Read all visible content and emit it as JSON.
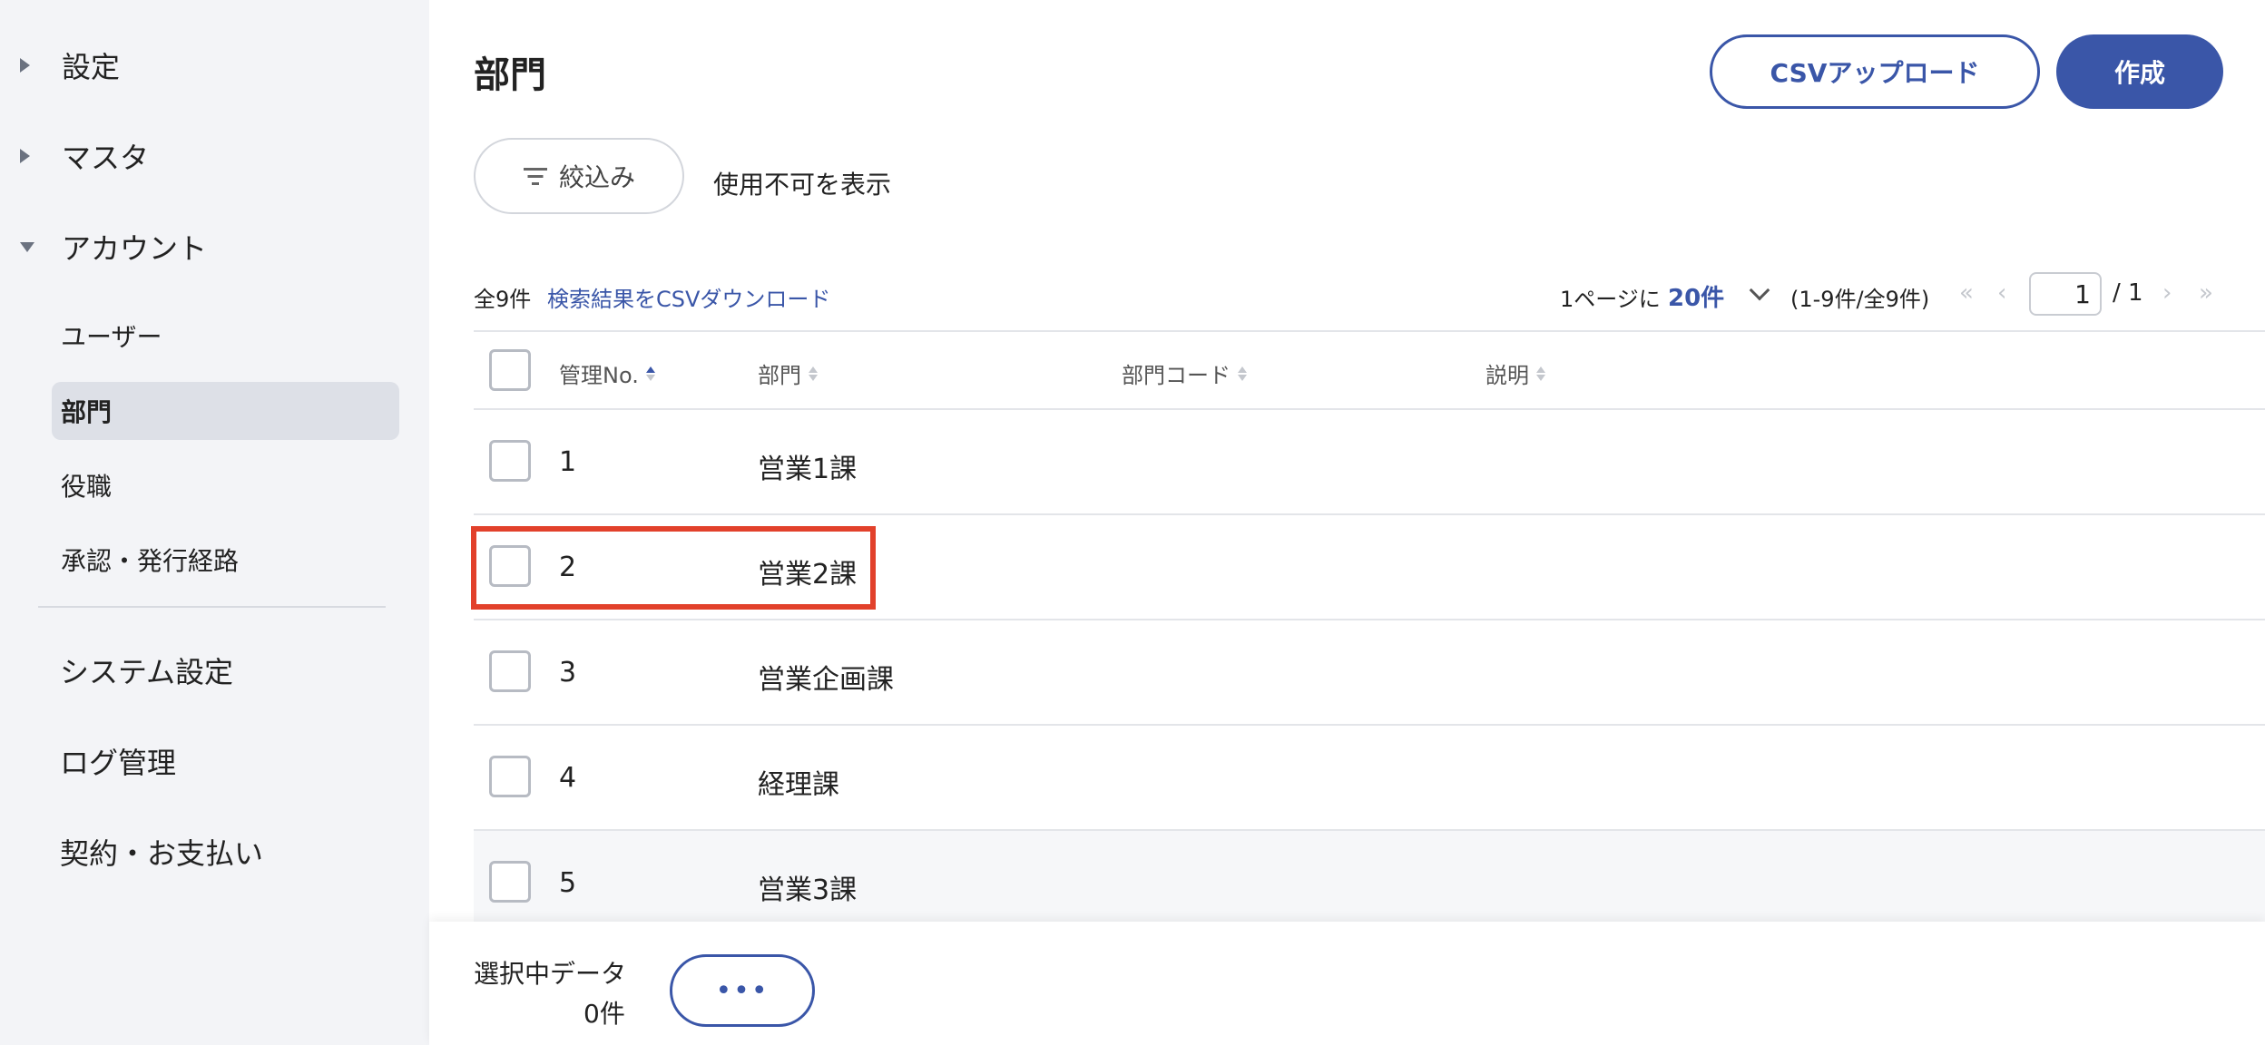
{
  "sidebar": {
    "sections": [
      {
        "label": "設定",
        "expanded": false
      },
      {
        "label": "マスタ",
        "expanded": false
      },
      {
        "label": "アカウント",
        "expanded": true
      }
    ],
    "account_items": [
      {
        "label": "ユーザー",
        "active": false
      },
      {
        "label": "部門",
        "active": true
      },
      {
        "label": "役職",
        "active": false
      },
      {
        "label": "承認・発行経路",
        "active": false
      }
    ],
    "links": [
      "システム設定",
      "ログ管理",
      "契約・お支払い"
    ]
  },
  "header": {
    "title": "部門",
    "csv_upload_label": "CSVアップロード",
    "create_label": "作成"
  },
  "filter": {
    "label": "絞込み",
    "show_disabled_label": "使用不可を表示"
  },
  "list_info": {
    "total": "全9件",
    "csv_download": "検索結果をCSVダウンロード",
    "per_page_label": "1ページに",
    "per_page_value": "20件",
    "range": "(1-9件/全9件)",
    "current_page": "1",
    "total_pages": "/ 1"
  },
  "table": {
    "headers": [
      "管理No.",
      "部門",
      "部門コード",
      "説明"
    ],
    "rows": [
      {
        "no": "1",
        "dept": "営業1課",
        "code": "",
        "desc": ""
      },
      {
        "no": "2",
        "dept": "営業2課",
        "code": "",
        "desc": ""
      },
      {
        "no": "3",
        "dept": "営業企画課",
        "code": "",
        "desc": ""
      },
      {
        "no": "4",
        "dept": "経理課",
        "code": "",
        "desc": ""
      },
      {
        "no": "5",
        "dept": "営業3課",
        "code": "",
        "desc": ""
      }
    ]
  },
  "footer": {
    "selected_label": "選択中データ",
    "selected_count": "0件",
    "more_label": "•••"
  },
  "colors": {
    "accent": "#3a56a8",
    "highlight": "#e2412b",
    "sidebar_bg": "#f3f4f7"
  }
}
